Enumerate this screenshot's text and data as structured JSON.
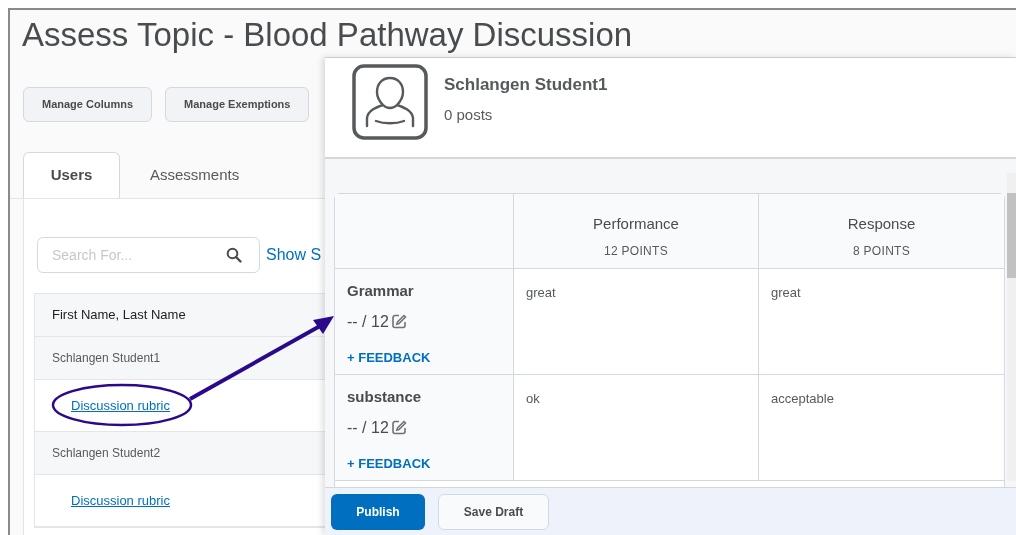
{
  "title": "Assess Topic - Blood Pathway Discussion",
  "toolbar": [
    "Manage Columns",
    "Manage Exemptions"
  ],
  "tabs": [
    {
      "label": "Users",
      "selected": true
    },
    {
      "label": "Assessments",
      "selected": false
    }
  ],
  "search": {
    "placeholder": "Search For...",
    "link": "Show S"
  },
  "users_table": {
    "column": "First Name, Last Name",
    "rows": [
      {
        "kind": "name",
        "text": "Schlangen Student1"
      },
      {
        "kind": "link",
        "text": "Discussion rubric"
      },
      {
        "kind": "name",
        "text": "Schlangen Student2"
      },
      {
        "kind": "link",
        "text": "Discussion rubric"
      }
    ]
  },
  "panel": {
    "student": "Schlangen Student1",
    "posts": "0 posts",
    "rubric": {
      "levels": [
        {
          "name": "Performance",
          "points": "12 POINTS"
        },
        {
          "name": "Response",
          "points": "8 POINTS"
        }
      ],
      "criteria": [
        {
          "name": "Grammar",
          "score": "-- / 12",
          "feedback": "+ FEEDBACK",
          "cells": [
            "great",
            "great"
          ]
        },
        {
          "name": "substance",
          "score": "-- / 12",
          "feedback": "+ FEEDBACK",
          "cells": [
            "ok",
            "acceptable"
          ]
        }
      ]
    },
    "buttons": [
      {
        "label": "Publish",
        "primary": true
      },
      {
        "label": "Save Draft",
        "primary": false
      }
    ]
  }
}
